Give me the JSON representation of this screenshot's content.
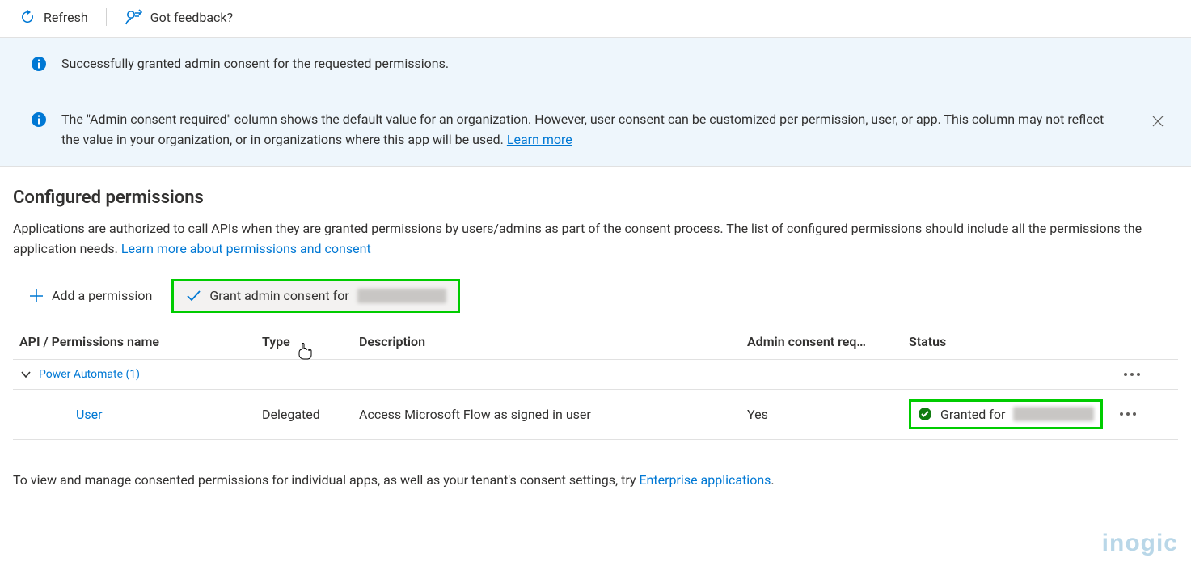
{
  "toolbar": {
    "refresh_label": "Refresh",
    "feedback_label": "Got feedback?"
  },
  "banners": {
    "success": "Successfully granted admin consent for the requested permissions.",
    "info_text": "The \"Admin consent required\" column shows the default value for an organization. However, user consent can be customized per permission, user, or app. This column may not reflect the value in your organization, or in organizations where this app will be used. ",
    "info_link": "Learn more"
  },
  "section": {
    "title": "Configured permissions",
    "desc_text": "Applications are authorized to call APIs when they are granted permissions by users/admins as part of the consent process. The list of configured permissions should include all the permissions the application needs. ",
    "desc_link": "Learn more about permissions and consent"
  },
  "actions": {
    "add_label": "Add a permission",
    "grant_label": "Grant admin consent for "
  },
  "table": {
    "headers": {
      "api": "API / Permissions name",
      "type": "Type",
      "desc": "Description",
      "admin": "Admin consent req…",
      "status": "Status"
    },
    "group": {
      "label": "Power Automate (1)"
    },
    "rows": [
      {
        "name": "User",
        "type": "Delegated",
        "desc": "Access Microsoft Flow as signed in user",
        "admin": "Yes",
        "status_prefix": "Granted for "
      }
    ]
  },
  "footer": {
    "text": "To view and manage consented permissions for individual apps, as well as your tenant's consent settings, try ",
    "link": "Enterprise applications",
    "suffix": "."
  },
  "watermark": "inogic"
}
